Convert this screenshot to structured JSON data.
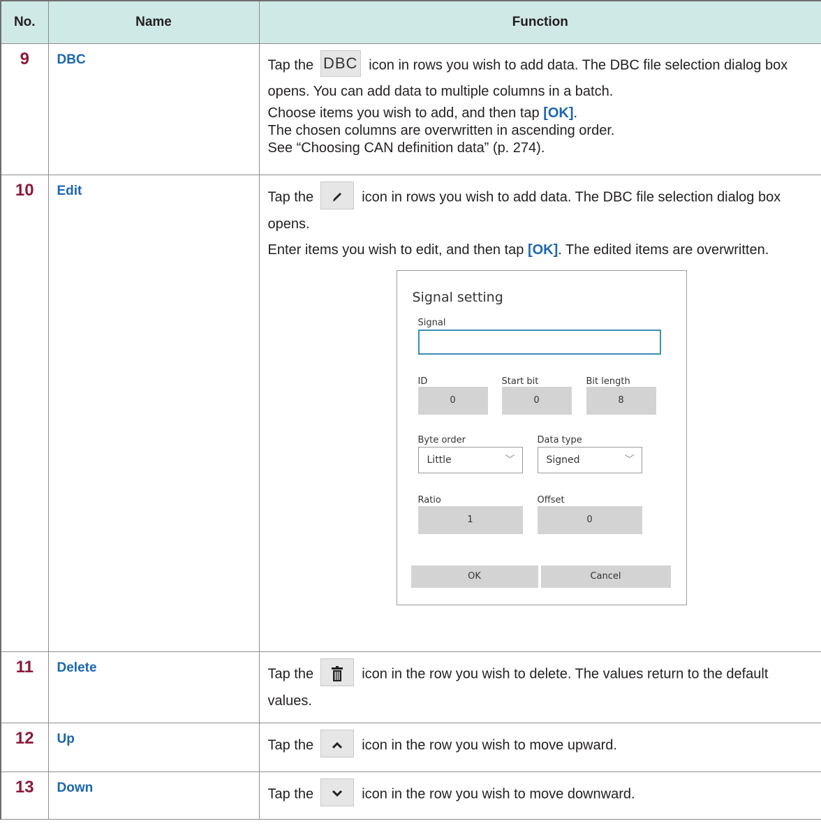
{
  "headers": {
    "no": "No.",
    "name": "Name",
    "function": "Function"
  },
  "rows": [
    {
      "no": "9",
      "name": "DBC",
      "text_before_icon": "Tap the",
      "icon_label": "DBC",
      "text_after_icon": "icon in rows you wish to add data. The DBC file selection dialog box opens. You can add data to multiple columns in a batch.",
      "line2_before": "Choose items you wish to add, and then tap ",
      "ok_label": "[OK]",
      "line2_after": ".",
      "line3": "The chosen columns are overwritten in ascending order.",
      "line4": "See “Choosing CAN definition data” (p. 274)."
    },
    {
      "no": "10",
      "name": "Edit",
      "text_before_icon": "Tap the",
      "text_after_icon": "icon in rows you wish to add data. The DBC file selection dialog box opens.",
      "line2_before": "Enter items you wish to edit, and then tap ",
      "ok_label": "[OK]",
      "line2_after": ". The edited items are overwritten.",
      "dialog": {
        "title": "Signal setting",
        "signal_label": "Signal",
        "signal_value": "",
        "id_label": "ID",
        "id_value": "0",
        "start_bit_label": "Start bit",
        "start_bit_value": "0",
        "bit_length_label": "Bit length",
        "bit_length_value": "8",
        "byte_order_label": "Byte order",
        "byte_order_value": "Little",
        "data_type_label": "Data type",
        "data_type_value": "Signed",
        "ratio_label": "Ratio",
        "ratio_value": "1",
        "offset_label": "Offset",
        "offset_value": "0",
        "ok_button": "OK",
        "cancel_button": "Cancel"
      }
    },
    {
      "no": "11",
      "name": "Delete",
      "text_before_icon": "Tap the",
      "text_after_icon": "icon in the row you wish to delete. The values return to the default values."
    },
    {
      "no": "12",
      "name": "Up",
      "text_before_icon": "Tap the",
      "text_after_icon": "icon in the row you wish to move upward."
    },
    {
      "no": "13",
      "name": "Down",
      "text_before_icon": "Tap the",
      "text_after_icon": "icon in the row you wish to move downward."
    }
  ],
  "icons": {
    "edit": "pencil-icon",
    "delete": "trash-icon",
    "up": "chevron-up-icon",
    "down": "chevron-down-icon"
  },
  "colors": {
    "header_bg": "#cfe9e6",
    "number": "#8b1a3c",
    "name": "#1a66b3",
    "focus_border": "#3a8fb8"
  }
}
